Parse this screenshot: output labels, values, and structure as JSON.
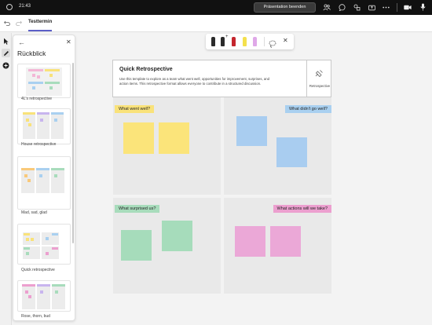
{
  "topbar": {
    "time": "21:43",
    "present_button": "Präsentation beenden",
    "icons": [
      "people-icon",
      "chat-icon",
      "apps-icon",
      "share-icon",
      "more-icon",
      "camera-icon",
      "mic-icon"
    ]
  },
  "toolbar": {
    "tab_title": "Testtermin",
    "icons": [
      "undo-icon",
      "redo-icon"
    ]
  },
  "rail": {
    "icons": [
      "select-icon",
      "pen-icon",
      "add-icon"
    ]
  },
  "panel": {
    "title": "Rückblick",
    "templates": [
      {
        "label": "4L's retrospective"
      },
      {
        "label": "House retrospective"
      },
      {
        "label": "Mad, sad, glad"
      },
      {
        "label": "Quick retrospective"
      },
      {
        "label": "Rose, thorn, bud"
      }
    ]
  },
  "ink_toolbar": {
    "tools": [
      "black-pen",
      "pen-with-plus",
      "red-pen",
      "yellow-highlighter",
      "pink-highlighter",
      "lasso-select"
    ]
  },
  "board": {
    "header": {
      "title": "Quick Retrospective",
      "description": "Use this template to explore as a team what went well, opportunities for improvement, surprises, and action items. This retrospective format allows everyone to contribute in a structured discussion.",
      "tag": "Retrospective"
    },
    "quadrants": [
      {
        "label": "What went well?",
        "color": "#f9e27a"
      },
      {
        "label": "What didn't go well?",
        "color": "#a9d0f0"
      },
      {
        "label": "What surprised us?",
        "color": "#a8dcbc"
      },
      {
        "label": "What actions will we take?",
        "color": "#ec9fcf"
      }
    ]
  },
  "colors": {
    "topbar": "#111111",
    "accent": "#5b5fc7",
    "yellow_note": "#fbe47a",
    "blue_note": "#a9cdf0",
    "green_note": "#a6dcbb",
    "pink_note": "#eba8d7"
  }
}
